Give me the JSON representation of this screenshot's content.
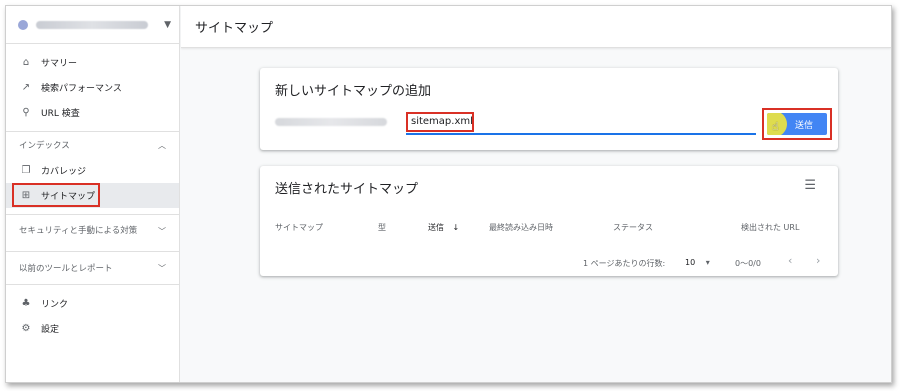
{
  "header": {
    "title": "サイトマップ"
  },
  "sidebar": {
    "top_items": [
      {
        "label": "サマリー",
        "icon": "home-icon"
      },
      {
        "label": "検索パフォーマンス",
        "icon": "trending-up-icon"
      },
      {
        "label": "URL 検査",
        "icon": "search-icon"
      }
    ],
    "index_section": {
      "label": "インデックス",
      "items": [
        {
          "label": "カバレッジ",
          "icon": "copy-icon"
        },
        {
          "label": "サイトマップ",
          "icon": "sitemap-icon"
        }
      ]
    },
    "security_section": {
      "label": "セキュリティと手動による対策"
    },
    "legacy_section": {
      "label": "以前のツールとレポート"
    },
    "bottom_items": [
      {
        "label": "リンク",
        "icon": "links-icon"
      },
      {
        "label": "設定",
        "icon": "gear-icon"
      }
    ]
  },
  "add_card": {
    "title": "新しいサイトマップの追加",
    "input_value": "sitemap.xml",
    "submit_label": "送信"
  },
  "submitted_card": {
    "title": "送信されたサイトマップ",
    "columns": [
      "サイトマップ",
      "型",
      "送信",
      "最終読み込み日時",
      "ステータス",
      "検出された URL"
    ],
    "sort_icon": "arrow-down-icon",
    "pager": {
      "rows_label": "1 ページあたりの行数:",
      "rows_value": "10",
      "range": "0〜0/0"
    }
  },
  "colors": {
    "accent": "#1a73e8",
    "button": "#4285f4",
    "highlight_box": "#d93025",
    "cursor_halo": "#f0e63c"
  }
}
